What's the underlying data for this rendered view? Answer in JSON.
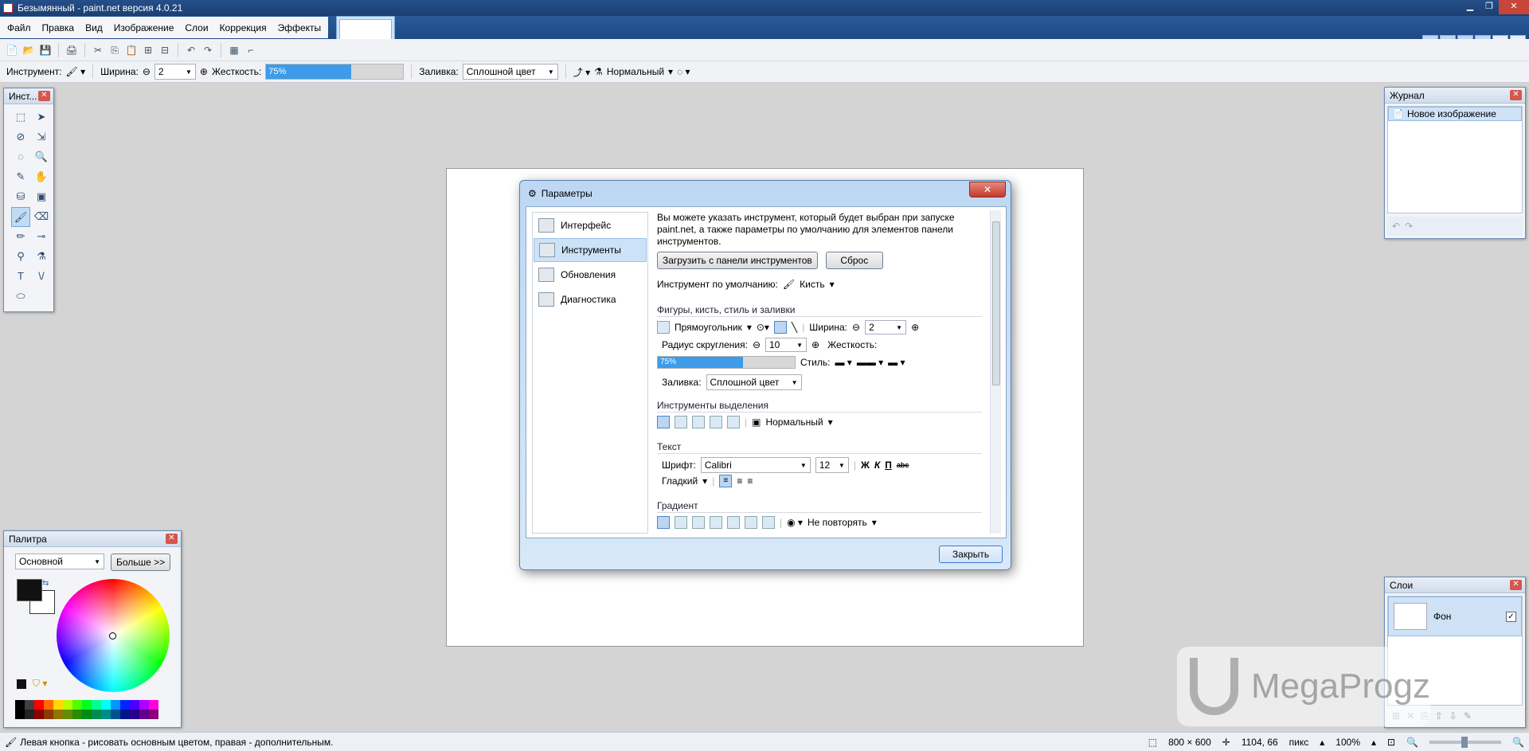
{
  "window": {
    "title": "Безымянный - paint.net версия 4.0.21",
    "buttons": [
      "▁",
      "❐",
      "✕"
    ]
  },
  "menu": [
    "Файл",
    "Правка",
    "Вид",
    "Изображение",
    "Слои",
    "Коррекция",
    "Эффекты"
  ],
  "thumb_arrow": "▾",
  "right_tools": [
    {
      "icon": "hammer-icon",
      "glyph": "⚒"
    },
    {
      "icon": "clock-icon",
      "glyph": "◷"
    },
    {
      "icon": "layers-icon",
      "glyph": "▦"
    },
    {
      "icon": "color-wheel-icon",
      "glyph": "◉"
    },
    {
      "icon": "gear-icon",
      "glyph": "⚙"
    },
    {
      "icon": "help-icon",
      "glyph": "?"
    }
  ],
  "toolbar1": [
    "📄",
    "📂",
    "💾",
    "🖨",
    "✂",
    "⎘",
    "📋",
    "⊞",
    "⊟",
    "↶",
    "↷",
    "▦",
    "⌐"
  ],
  "toolbar2": {
    "tool_label": "Инструмент:",
    "width_label": "Ширина:",
    "width_value": "2",
    "hardness_label": "Жесткость:",
    "hardness_value": "75%",
    "hardness_level": 0.62,
    "fill_label": "Заливка:",
    "fill_value": "Сплошной цвет",
    "blend_value": "Нормальный"
  },
  "tools_window": {
    "title": "Инст...",
    "tools": [
      "⬚",
      "➤",
      "⊘",
      "⇲",
      "◌",
      "🔍",
      "✎",
      "✋",
      "⛁",
      "▣",
      "🖌",
      "⌫",
      "✏",
      "⊸",
      "⚲",
      "⚗",
      "T",
      "\\/",
      "⬭",
      ""
    ]
  },
  "history_window": {
    "title": "Журнал",
    "items": [
      "Новое изображение"
    ]
  },
  "palette_window": {
    "title": "Палитра",
    "select_value": "Основной",
    "more_button": "Больше >>",
    "colors": {
      "primary": "#111111",
      "secondary": "#ffffff"
    },
    "swatches": [
      "#000000",
      "#404040",
      "#ff0000",
      "#ff6a00",
      "#ffd800",
      "#b6ff00",
      "#4cff00",
      "#00ff21",
      "#00ff90",
      "#00ffff",
      "#0094ff",
      "#0026ff",
      "#4800ff",
      "#b200ff",
      "#ff00dc"
    ]
  },
  "layers_window": {
    "title": "Слои",
    "items": [
      {
        "name": "Фон",
        "visible": "✓"
      }
    ]
  },
  "dialog": {
    "title": "Параметры",
    "close_x": "✕",
    "nav": [
      {
        "label": "Интерфейс",
        "selected": false
      },
      {
        "label": "Инструменты",
        "selected": true
      },
      {
        "label": "Обновления",
        "selected": false
      },
      {
        "label": "Диагностика",
        "selected": false
      }
    ],
    "description": "Вы можете указать инструмент, который будет выбран при запуске paint.net, а также параметры по умолчанию для элементов панели инструментов.",
    "load_button": "Загрузить с панели инструментов",
    "reset_button": "Сброс",
    "default_tool_label": "Инструмент по умолчанию:",
    "default_tool_value": "Кисть",
    "sections": {
      "shapes": "Фигуры, кисть, стиль и заливки",
      "selection": "Инструменты выделения",
      "text": "Текст",
      "gradient": "Градиент"
    },
    "shape_value": "Прямоугольник",
    "width_label": "Ширина:",
    "width_value": "2",
    "radius_label": "Радиус скругления:",
    "radius_value": "10",
    "hardness_label": "Жесткость:",
    "hardness_value": "75%",
    "style_label": "Стиль:",
    "fill_label": "Заливка:",
    "fill_value": "Сплошной цвет",
    "selection_mode": "Нормальный",
    "font_label": "Шрифт:",
    "font_value": "Calibri",
    "font_size": "12",
    "format_buttons": [
      "Ж",
      "К",
      "П",
      "abc"
    ],
    "smoothing_value": "Гладкий",
    "gradient_repeat": "Не повторять",
    "close_button": "Закрыть"
  },
  "status": {
    "hint": "Левая кнопка - рисовать основным цветом, правая - дополнительным.",
    "size": "800 × 600",
    "cursor": "1104, 66",
    "units": "пикс",
    "zoom": "100%"
  },
  "watermark": "MegaProgz"
}
